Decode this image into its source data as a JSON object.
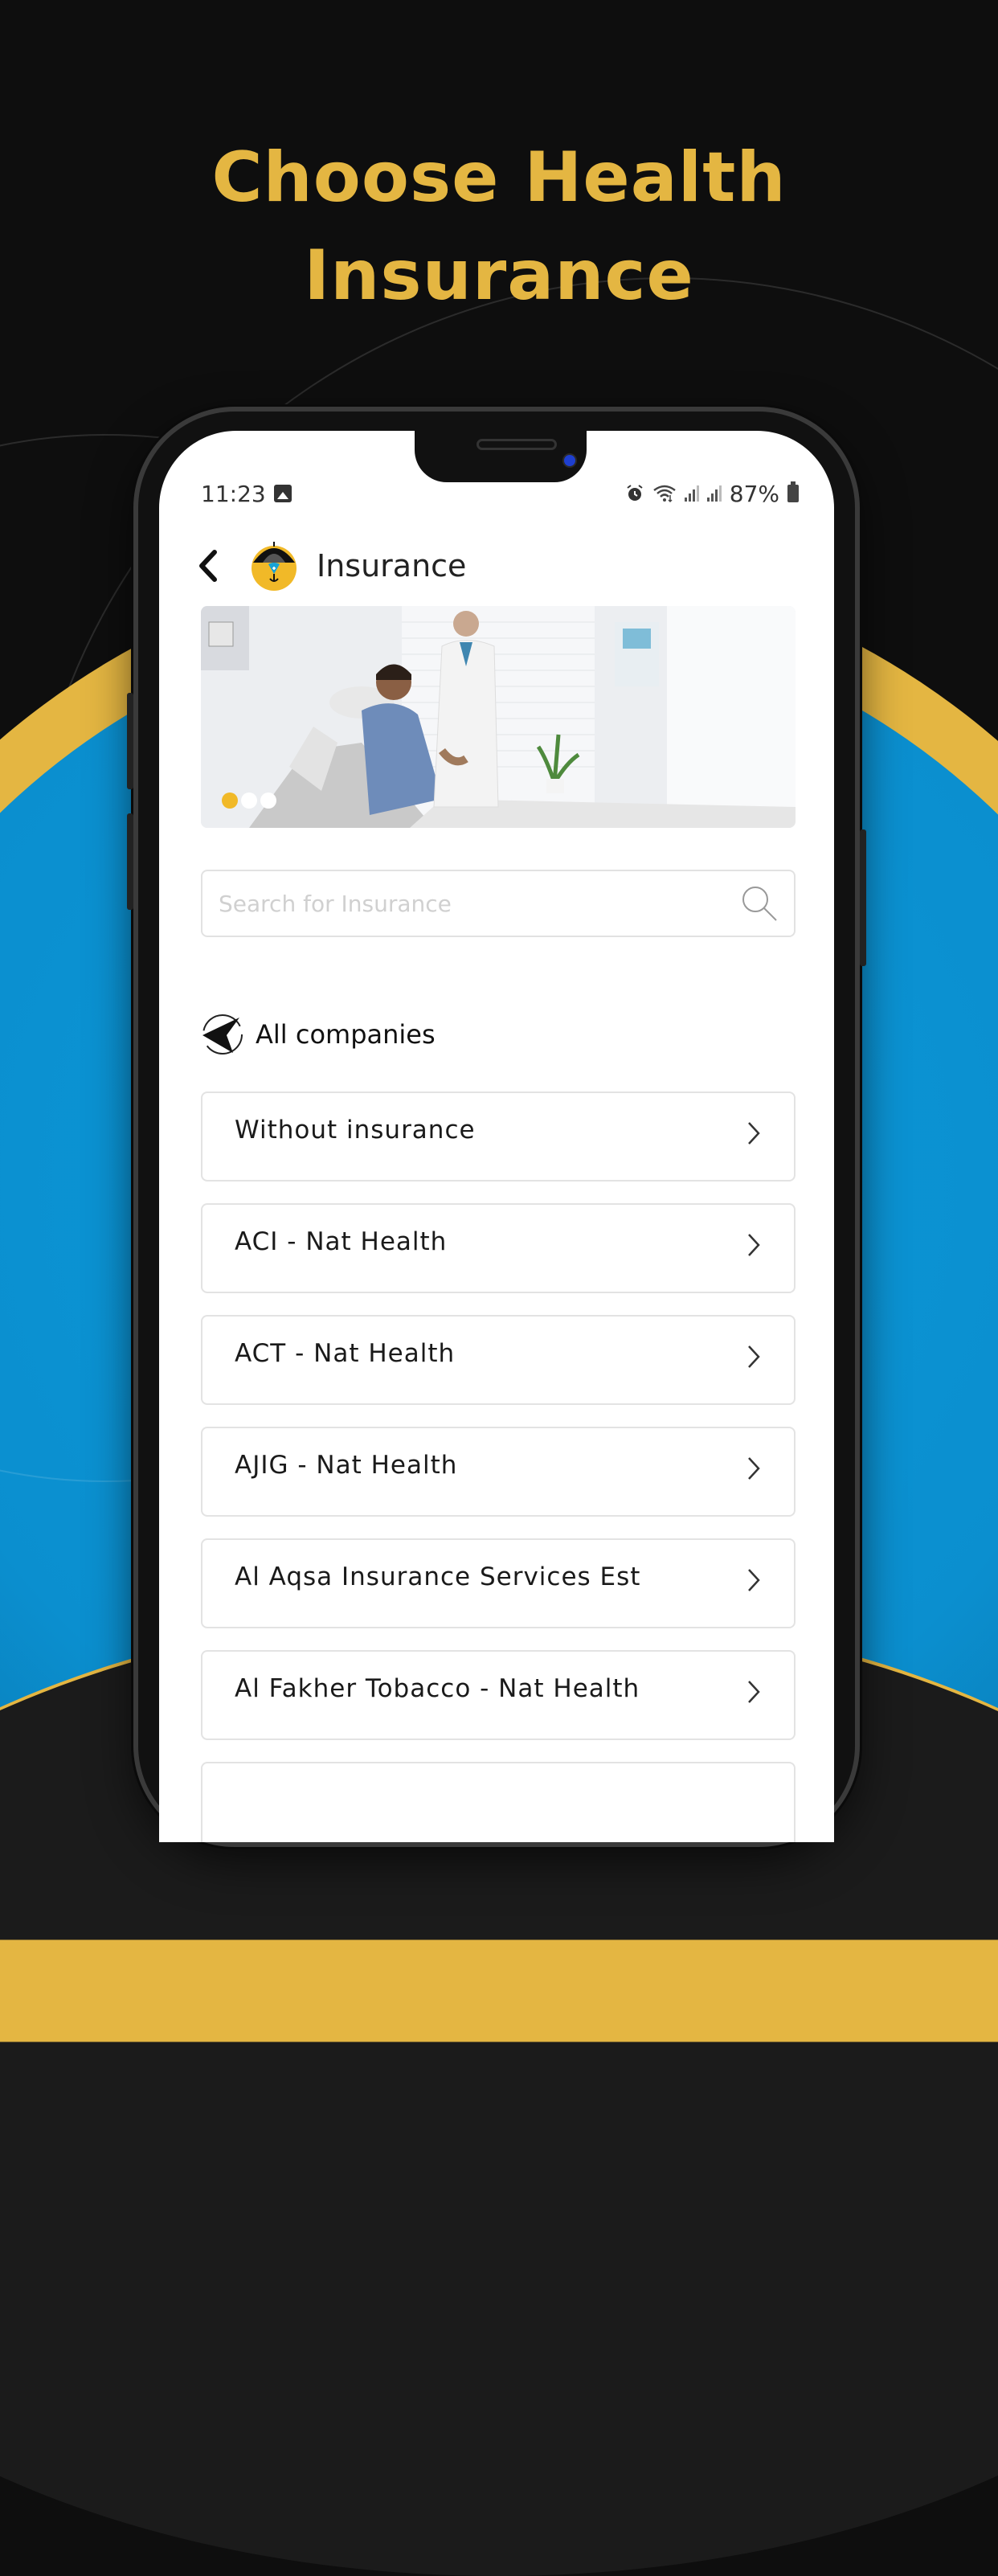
{
  "promo": {
    "headline_line1": "Choose Health",
    "headline_line2": "Insurance",
    "colors": {
      "gold": "#e4b642",
      "blue": "#0a98d8",
      "dark": "#0e0e0e"
    }
  },
  "status_bar": {
    "time": "11:23",
    "battery": "87%",
    "icons": [
      "image-icon",
      "alarm-icon",
      "wifi-icon",
      "signal-icon",
      "signal-icon",
      "battery-icon"
    ]
  },
  "header": {
    "back_icon": "chevron-left-icon",
    "logo_icon": "umbrella-shield-logo",
    "title": "Insurance"
  },
  "banner": {
    "slide_count": 3,
    "active_slide": 1,
    "alt": "Doctor holding hands with patient in hospital bed"
  },
  "search": {
    "placeholder": "Search for Insurance",
    "value": "",
    "icon": "search-icon"
  },
  "section": {
    "icon": "navigation-arrow-icon",
    "title": "All companies"
  },
  "companies": [
    {
      "label": "Without insurance"
    },
    {
      "label": "ACI - Nat Health"
    },
    {
      "label": "ACT - Nat Health"
    },
    {
      "label": "AJIG - Nat Health"
    },
    {
      "label": "Al Aqsa Insurance Services Est"
    },
    {
      "label": "Al Fakher Tobacco - Nat Health"
    },
    {
      "label": ""
    }
  ]
}
